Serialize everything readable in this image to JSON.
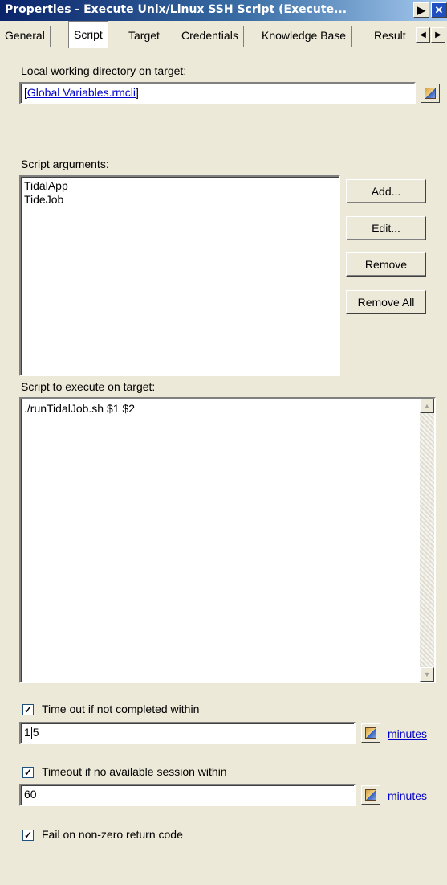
{
  "window": {
    "title": "Properties - Execute Unix/Linux SSH Script (Execute...",
    "next_icon": "triangle-right-icon",
    "close_icon": "close-icon"
  },
  "tabs": [
    {
      "label": "General"
    },
    {
      "label": "Script"
    },
    {
      "label": "Target"
    },
    {
      "label": "Credentials"
    },
    {
      "label": "Knowledge Base"
    },
    {
      "label": "Result"
    }
  ],
  "script_tab": {
    "working_dir": {
      "label": "Local working directory on target:",
      "value_prefix": "[",
      "value_link": "Global Variables.rmcli",
      "value_suffix": "]"
    },
    "arguments": {
      "label": "Script arguments:",
      "items": [
        "TidalApp",
        "TideJob"
      ],
      "buttons": {
        "add": "Add...",
        "edit": "Edit...",
        "remove": "Remove",
        "remove_all": "Remove All"
      }
    },
    "script": {
      "label": "Script to execute on target:",
      "value": "./runTidalJob.sh $1 $2"
    },
    "timeout": {
      "label": "Time out if not completed within",
      "checked": true,
      "value_before_caret": "1",
      "value_after_caret": "5",
      "unit": "minutes"
    },
    "session_timeout": {
      "label": "Timeout if no available session within",
      "checked": true,
      "value": "60",
      "unit": "minutes"
    },
    "fail_nonzero": {
      "label": "Fail on non-zero return code",
      "checked": true
    }
  }
}
